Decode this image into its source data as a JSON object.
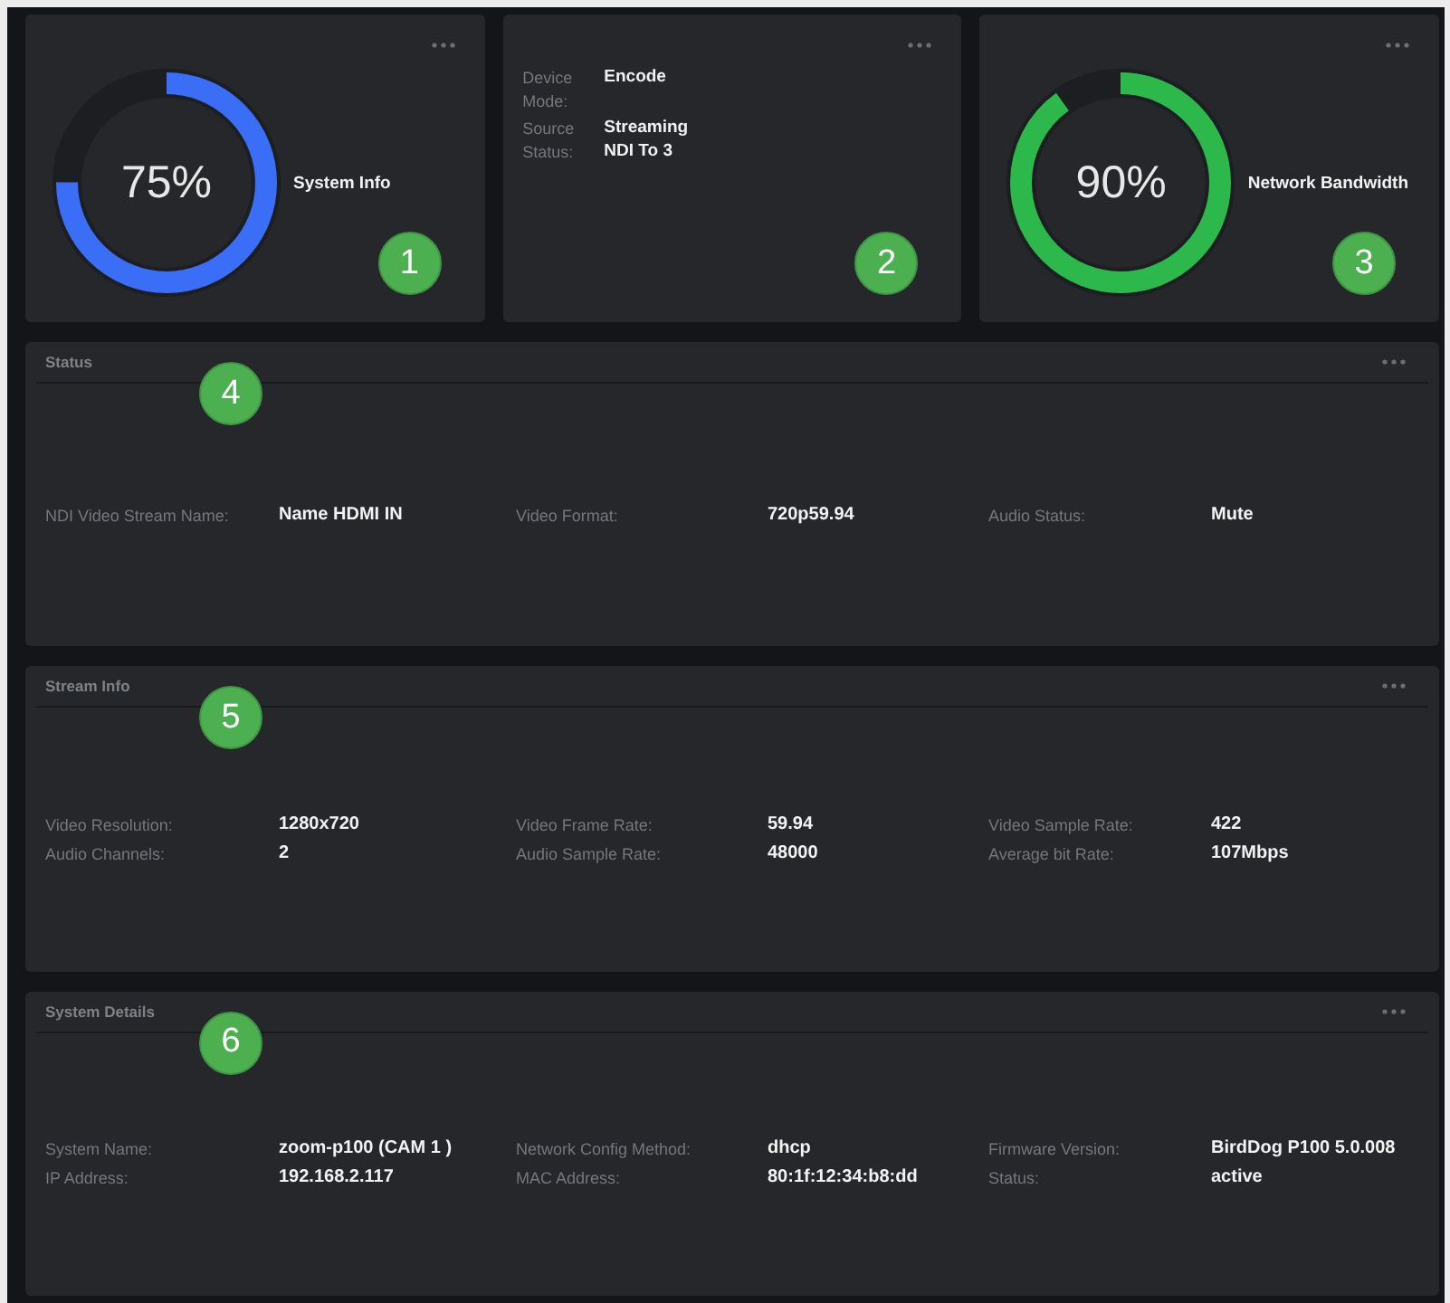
{
  "widgets": [
    {
      "kind": "gauge",
      "reading": "75%",
      "level": 0.75,
      "color": "#3b6ef6",
      "title": "System Info",
      "callout": "1"
    },
    {
      "kind": "fields",
      "fields": [
        {
          "label": "Device Mode:",
          "value": "Encode"
        },
        {
          "label": "Source Status:",
          "value": "Streaming NDI To 3"
        }
      ],
      "callout": "2"
    },
    {
      "kind": "gauge",
      "reading": "90%",
      "level": 0.9,
      "color": "#2cb84b",
      "title": "Network Bandwidth",
      "callout": "3"
    }
  ],
  "panels": [
    {
      "title": "Status",
      "callout": "4",
      "rows": [
        [
          {
            "label": "NDI Video Stream Name:",
            "value": "Name HDMI IN"
          },
          {
            "label": "Video Format:",
            "value": "720p59.94"
          },
          {
            "label": "Audio Status:",
            "value": "Mute"
          }
        ]
      ]
    },
    {
      "title": "Stream Info",
      "callout": "5",
      "rows": [
        [
          {
            "label": "Video Resolution:",
            "value": "1280x720"
          },
          {
            "label": "Video Frame Rate:",
            "value": "59.94"
          },
          {
            "label": "Video Sample Rate:",
            "value": "422"
          }
        ],
        [
          {
            "label": "Audio Channels:",
            "value": "2"
          },
          {
            "label": "Audio Sample Rate:",
            "value": "48000"
          },
          {
            "label": "Average bit Rate:",
            "value": "107Mbps"
          }
        ]
      ]
    },
    {
      "title": "System Details",
      "callout": "6",
      "rows": [
        [
          {
            "label": "System Name:",
            "value": "zoom-p100 (CAM 1 )"
          },
          {
            "label": "Network Config Method:",
            "value": "dhcp"
          },
          {
            "label": "Firmware Version:",
            "value": "BirdDog P100 5.0.008"
          }
        ],
        [
          {
            "label": "IP Address:",
            "value": "192.168.2.117"
          },
          {
            "label": "MAC Address:",
            "value": "80:1f:12:34:b8:dd"
          },
          {
            "label": "Status:",
            "value": "active"
          }
        ]
      ]
    }
  ]
}
